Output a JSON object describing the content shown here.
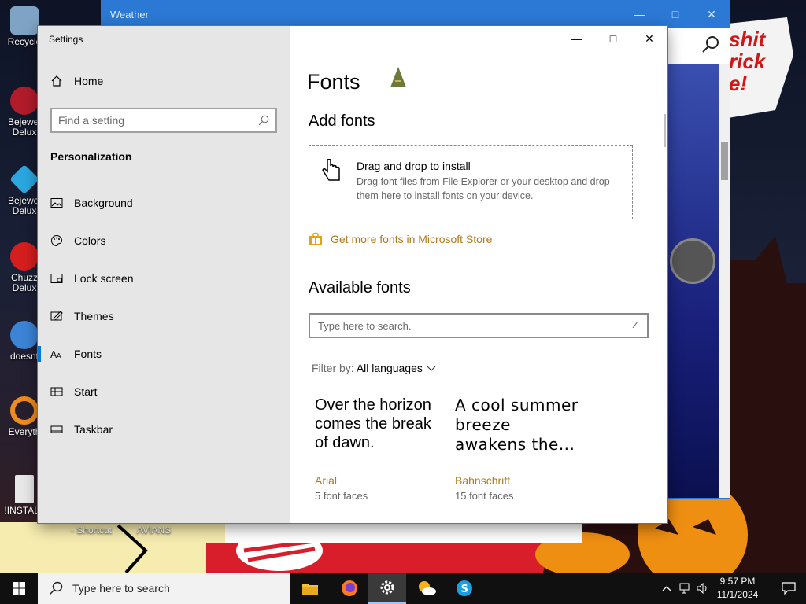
{
  "desktop": {
    "icons": [
      {
        "label": "Recycle",
        "color": "#7fa3c4"
      },
      {
        "label": "Bejewel Delux",
        "color": "#b21c2a"
      },
      {
        "label": "Bejewel Delux",
        "color": "#2aa7e0"
      },
      {
        "label": "Chuzz Delux",
        "color": "#d61e1e"
      },
      {
        "label": "doesnt",
        "color": "#3b84d6"
      },
      {
        "label": "Everyth",
        "color": "#f08c1e"
      },
      {
        "label": "!INSTALL",
        "color": "#e8e8e8"
      }
    ],
    "shortcut_labels": [
      "- Shortcut",
      "AVIANS"
    ],
    "banner_text": "shit\nrick\ne!"
  },
  "weather_window": {
    "title": "Weather"
  },
  "settings": {
    "window_title": "Settings",
    "home_label": "Home",
    "search_placeholder": "Find a setting",
    "section": "Personalization",
    "nav_items": [
      {
        "label": "Background",
        "icon": "background-icon"
      },
      {
        "label": "Colors",
        "icon": "colors-icon"
      },
      {
        "label": "Lock screen",
        "icon": "lock-screen-icon"
      },
      {
        "label": "Themes",
        "icon": "themes-icon"
      },
      {
        "label": "Fonts",
        "icon": "fonts-icon",
        "selected": true
      },
      {
        "label": "Start",
        "icon": "start-icon"
      },
      {
        "label": "Taskbar",
        "icon": "taskbar-icon"
      }
    ],
    "page_title": "Fonts",
    "add_fonts_heading": "Add fonts",
    "drop_title": "Drag and drop to install",
    "drop_desc": "Drag font files from File Explorer or your desktop and drop them here to install fonts on your device.",
    "store_link": "Get more fonts in Microsoft Store",
    "available_heading": "Available fonts",
    "font_search_placeholder": "Type here to search.",
    "filter_label": "Filter by:",
    "filter_value": "All languages",
    "font_cards": [
      {
        "sample": "Over the horizon comes the break of dawn.",
        "name": "Arial",
        "faces": "5 font faces"
      },
      {
        "sample": "A cool summer breeze awakens the...",
        "name": "Bahnschrift",
        "faces": "15 font faces"
      }
    ]
  },
  "taskbar": {
    "search_placeholder": "Type here to search",
    "apps": [
      "file-explorer-icon",
      "firefox-icon",
      "settings-gear-icon",
      "weather-icon",
      "skype-icon"
    ],
    "time": "9:57 PM",
    "date": "11/1/2024"
  },
  "colors": {
    "accent": "#0078d7",
    "link": "#b1791a",
    "weather_bar": "#2b79d4"
  }
}
